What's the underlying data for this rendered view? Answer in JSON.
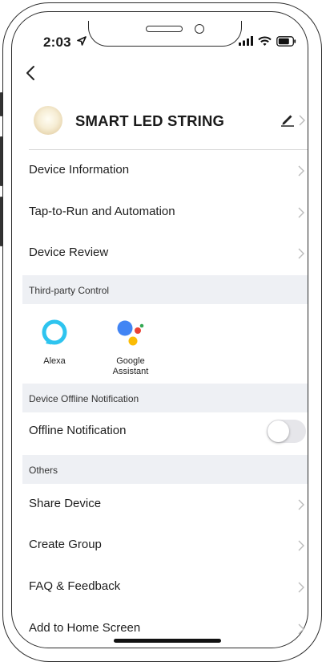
{
  "status_bar": {
    "time": "2:03"
  },
  "device": {
    "name": "SMART LED STRING"
  },
  "rows_top": [
    {
      "label": "Device Information"
    },
    {
      "label": "Tap-to-Run and Automation"
    },
    {
      "label": "Device Review"
    }
  ],
  "third_party": {
    "section_label": "Third-party Control",
    "alexa_label": "Alexa",
    "google_label_1": "Google",
    "google_label_2": "Assistant"
  },
  "offline": {
    "section_label": "Device Offline Notification",
    "label": "Offline Notification",
    "enabled": false
  },
  "others": {
    "section_label": "Others",
    "items": [
      {
        "label": "Share Device"
      },
      {
        "label": "Create Group"
      },
      {
        "label": "FAQ & Feedback"
      },
      {
        "label": "Add to Home Screen"
      }
    ]
  },
  "colors": {
    "section_bg": "#eef0f4",
    "alexa": "#2ec4ef",
    "google_blue": "#4285F4",
    "google_red": "#EA4335",
    "google_yellow": "#FBBC05",
    "google_green": "#34A853"
  }
}
